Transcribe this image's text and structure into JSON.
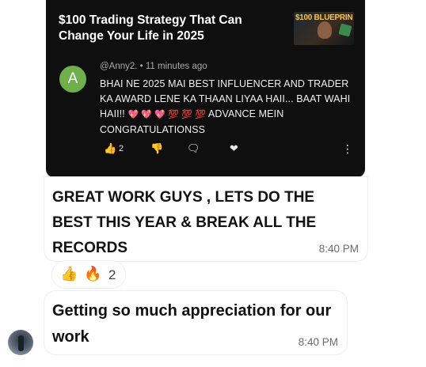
{
  "video": {
    "title": "$100 Trading Strategy That Can Change Your Life in 2025",
    "thumbnail_text": "$100 BLUEPRINT"
  },
  "comment": {
    "avatar_letter": "A",
    "meta": "@Anny2. • 11 minutes ago",
    "text_part1": "BHAI NE 2025 MAI BEST INFLUENCER AND TRADER KA AWARD LENE KA THAAN LIYAA HAII... BAAT WAHI HAII!!",
    "emojis": "💖 💖 💖 💯 💯 💯",
    "text_part2": "ADVANCE MEIN CONGRATULATIONSS",
    "like_count": "2"
  },
  "messages": [
    {
      "text": "GREAT WORK GUYS , LETS DO THE BEST THIS YEAR & BREAK ALL THE RECORDS",
      "time": "8:40 PM"
    },
    {
      "text": "Getting so much appreciation for our work",
      "time": "8:40 PM"
    }
  ],
  "reactions": {
    "emoji1": "👍",
    "emoji2": "🔥",
    "count": "2"
  }
}
